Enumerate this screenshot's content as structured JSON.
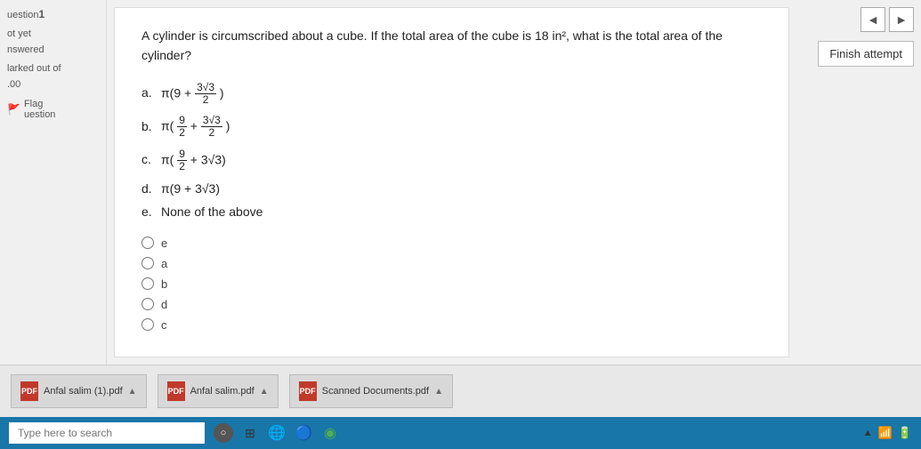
{
  "sidebar": {
    "question_label": "uestion",
    "question_number": "1",
    "status": "ot yet",
    "status2": "nswered",
    "marked_label": "larked out of",
    "marked_value": ".00",
    "flag_label": "Flag",
    "flag_sublabel": "uestion"
  },
  "question": {
    "text": "A cylinder is circumscribed about a cube. If the total area of the cube is 18 in², what is the total area of the cylinder?",
    "options": [
      {
        "id": "a",
        "label": "a.",
        "math": "π(9 + 3√3/2)"
      },
      {
        "id": "b",
        "label": "b.",
        "math": "π(9/2 + 3√3/2)"
      },
      {
        "id": "c",
        "label": "c.",
        "math": "π(9/2 + 3√3)"
      },
      {
        "id": "d",
        "label": "d.",
        "math": "π(9 + 3√3)"
      },
      {
        "id": "e",
        "label": "e.",
        "math": "None of the above"
      }
    ],
    "radio_options": [
      "e",
      "a",
      "b",
      "d",
      "c"
    ]
  },
  "right_panel": {
    "finish_label": "Finish attempt",
    "nav_prev": "◄",
    "nav_next": "►"
  },
  "taskbar": {
    "items": [
      {
        "label": "Anfal salim (1).pdf",
        "chevron": "▲"
      },
      {
        "label": "Anfal salim.pdf",
        "chevron": "▲"
      },
      {
        "label": "Scanned Documents.pdf",
        "chevron": "▲"
      }
    ],
    "search_placeholder": "Type here to search"
  }
}
